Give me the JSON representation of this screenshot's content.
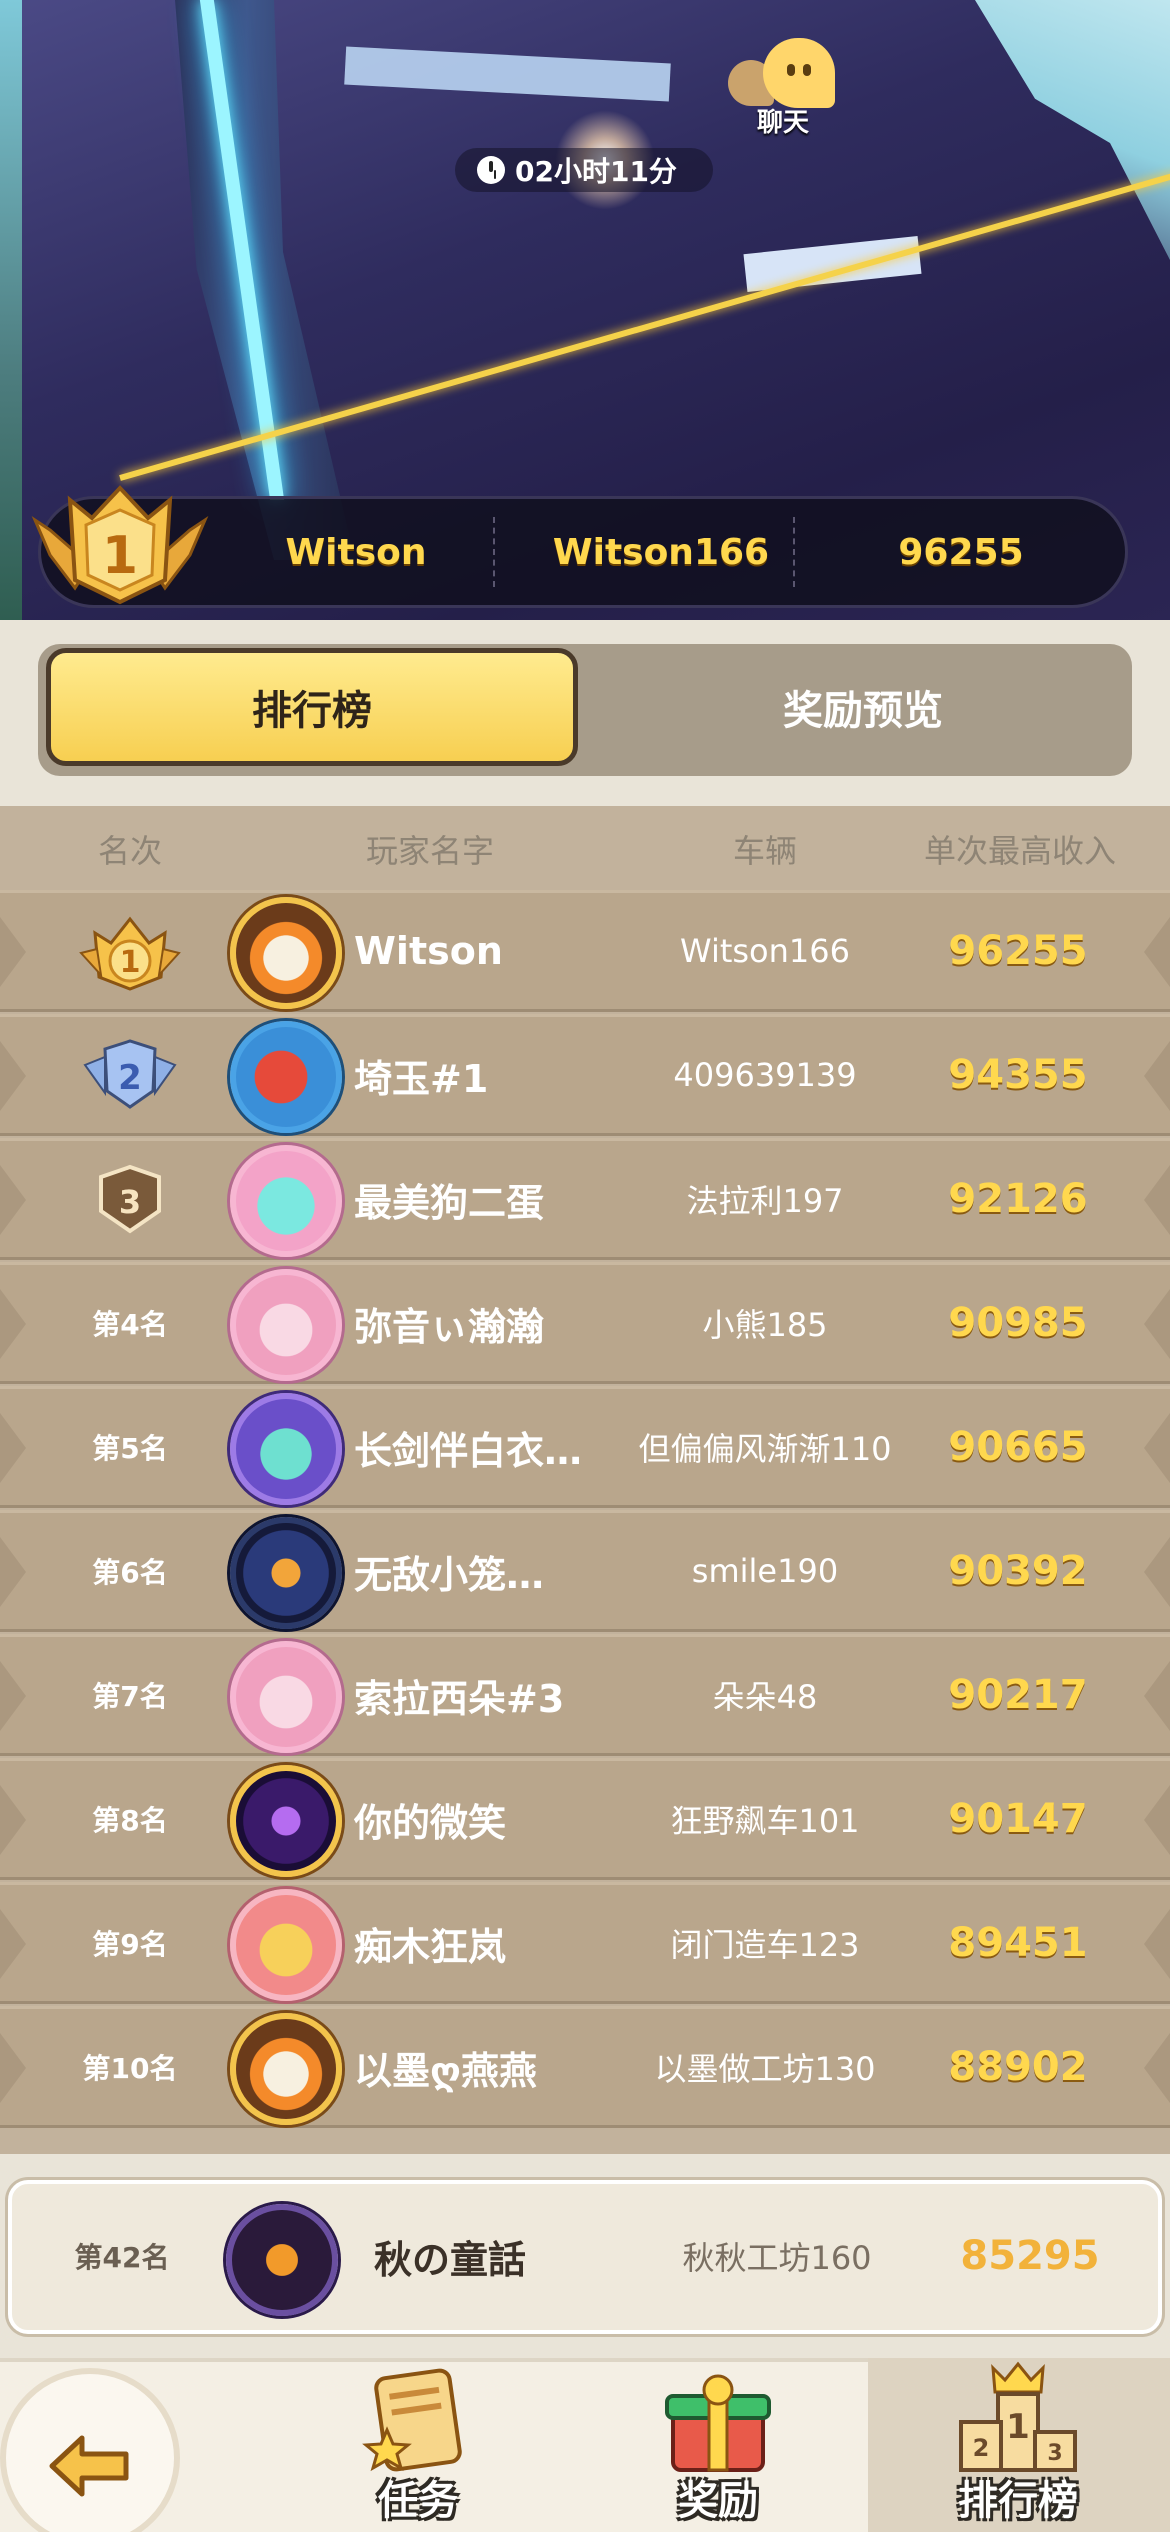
{
  "scene": {
    "timer": "02小时11分",
    "chat_label": "聊天"
  },
  "top_player": {
    "rank": "1",
    "name": "Witson",
    "vehicle": "Witson166",
    "score": "96255"
  },
  "tabs": {
    "leaderboard": "排行榜",
    "reward_preview": "奖励预览"
  },
  "table": {
    "headers": {
      "rank": "名次",
      "player": "玩家名字",
      "vehicle": "车辆",
      "score": "单次最高收入"
    },
    "rows": [
      {
        "rank": "1",
        "name": "Witson",
        "vehicle": "Witson166",
        "score": "96255"
      },
      {
        "rank": "2",
        "name": "埼玉#1",
        "vehicle": "409639139",
        "score": "94355"
      },
      {
        "rank": "3",
        "name": "最美狗二蛋",
        "vehicle": "法拉利197",
        "score": "92126"
      },
      {
        "rank": "第4名",
        "name": "弥音ぃ瀚瀚",
        "vehicle": "小熊185",
        "score": "90985"
      },
      {
        "rank": "第5名",
        "name": "长剑伴白衣…",
        "vehicle": "但偏偏风渐渐110",
        "score": "90665"
      },
      {
        "rank": "第6名",
        "name": "无敌小笼…",
        "vehicle": "smile190",
        "score": "90392"
      },
      {
        "rank": "第7名",
        "name": "索拉西朵#3",
        "vehicle": "朵朵48",
        "score": "90217"
      },
      {
        "rank": "第8名",
        "name": "你的微笑",
        "vehicle": "狂野飙车101",
        "score": "90147"
      },
      {
        "rank": "第9名",
        "name": "痴木狂岚",
        "vehicle": "闭门造车123",
        "score": "89451"
      },
      {
        "rank": "第10名",
        "name": "以墨ღ燕燕",
        "vehicle": "以墨做工坊130",
        "score": "88902"
      }
    ]
  },
  "my_entry": {
    "rank": "第42名",
    "name": "秋の童話",
    "vehicle": "秋秋工坊160",
    "score": "85295"
  },
  "bottom_nav": {
    "tasks": "任务",
    "rewards": "奖励",
    "leaderboard": "排行榜"
  },
  "colors": {
    "gold": "#ffd84e",
    "row_bg": "#b9a68c",
    "tab_active": "#f7cf51"
  }
}
